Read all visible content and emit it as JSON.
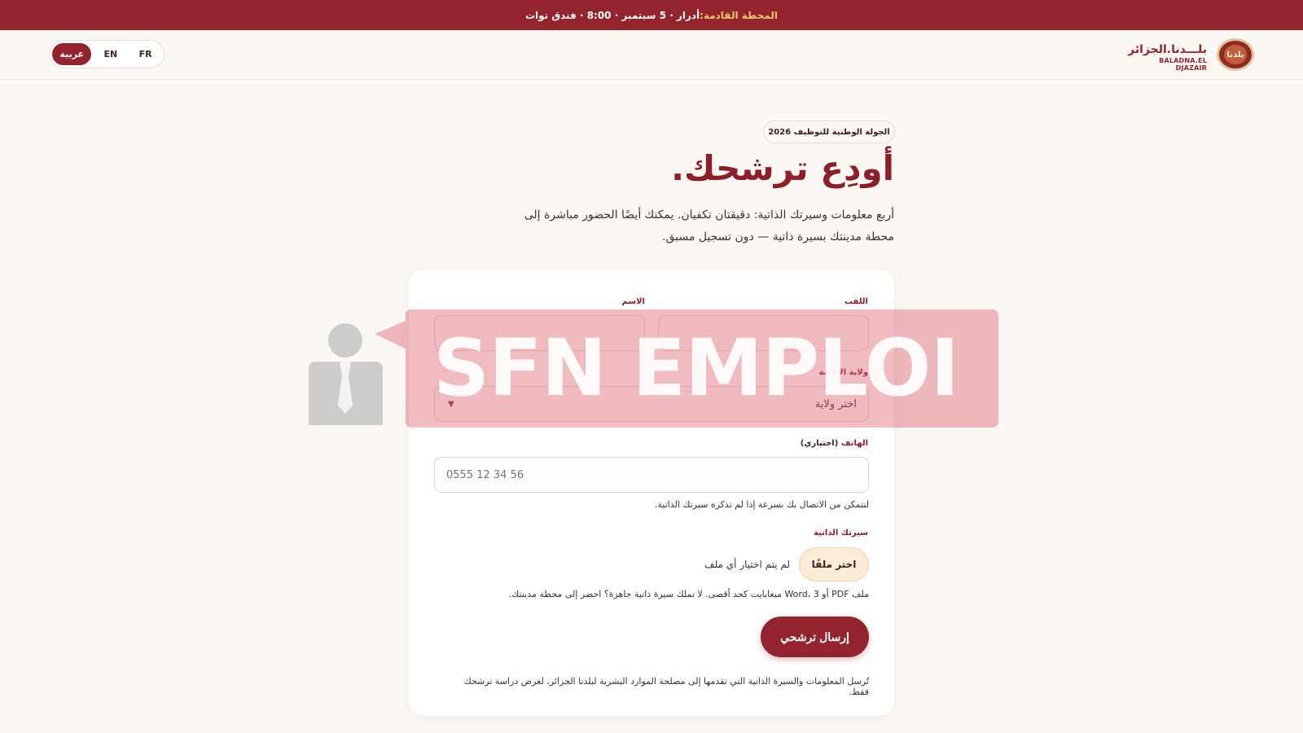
{
  "announcement": {
    "highlight": "المحطة القادمة:",
    "text": "أدرار · 5 سبتمبر · 8:00 · فندق توات"
  },
  "header": {
    "logo_ar": "بلـــدنا.الجزائر",
    "logo_latin": "BALADNA.EL DJAZAIR",
    "logo_badge": "بلدنا",
    "languages": [
      {
        "label": "عربية",
        "active": true
      },
      {
        "label": "EN",
        "active": false
      },
      {
        "label": "FR",
        "active": false
      }
    ]
  },
  "hero": {
    "chip": "الجولة الوطنية للتوظيف 2026",
    "title": "أودِع ترشحك.",
    "lead": "أربع معلومات وسيرتك الذاتية: دقيقتان تكفيان. يمكنك أيضًا الحضور مباشرة إلى محطة مدينتك بسيرة ذاتية — دون تسجيل مسبق."
  },
  "form": {
    "last_name_label": "اللقب",
    "first_name_label": "الاسم",
    "last_name_value": "",
    "first_name_value": "",
    "wilaya_label": "ولاية الإقامة",
    "wilaya_value": "اختر ولاية",
    "phone_label": "الهاتف",
    "phone_optional": "(اختياري)",
    "phone_placeholder": "0555 12 34 56",
    "phone_hint": "لنتمكن من الاتصال بك بسرعة إذا لم تذكره سيرتك الذاتية.",
    "cv_label": "سيرتك الذاتية",
    "cv_button": "اختر ملفًا",
    "cv_status": "لم يتم اختيار أي ملف",
    "cv_hint": "ملف PDF أو Word، 3 ميغابايت كحد أقصى. لا تملك سيرة ذاتية جاهزة؟ احضر إلى محطة مدينتك.",
    "submit": "إرسال ترشحي",
    "footnote": "تُرسل المعلومات والسيرة الذاتية التي تقدمها إلى مصلحة الموارد البشرية لبلدنا الجزائر، لغرض دراسة ترشحك فقط."
  },
  "watermark": {
    "text": "SFN EMPLOI"
  },
  "colors": {
    "brand": "#93232c",
    "accent": "#f2c46e",
    "background": "#fbf8f4"
  }
}
